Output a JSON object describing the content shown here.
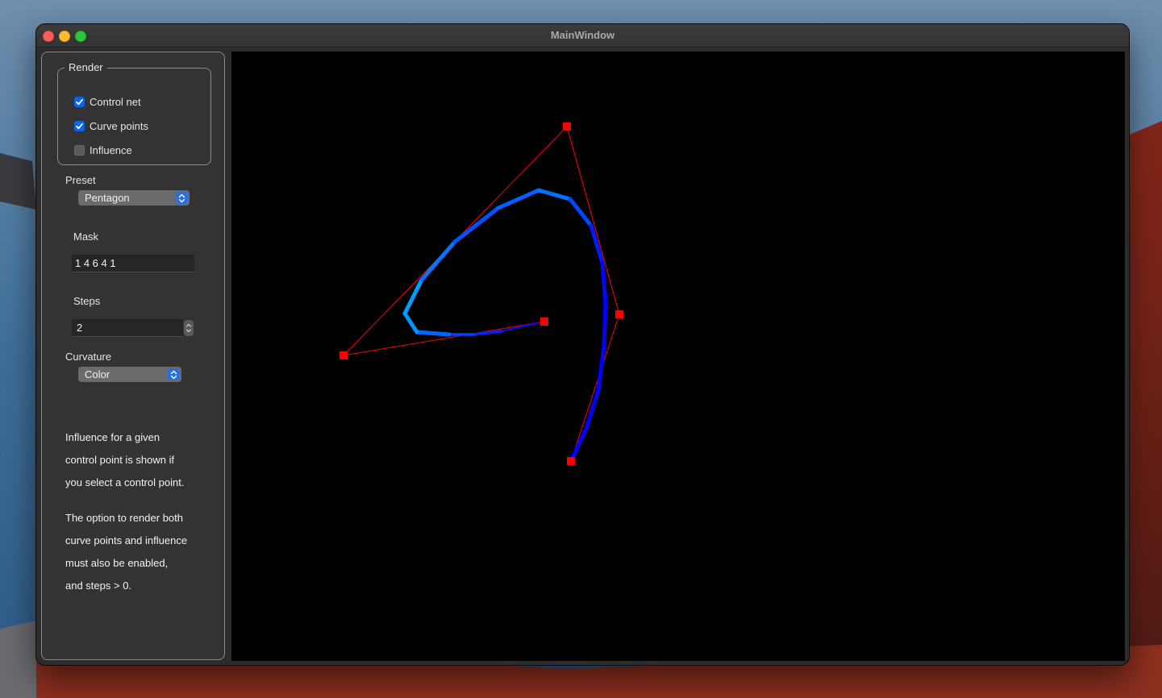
{
  "window": {
    "title": "MainWindow"
  },
  "render_group": {
    "title": "Render",
    "options": [
      {
        "label": "Control net",
        "checked": true
      },
      {
        "label": "Curve points",
        "checked": true
      },
      {
        "label": "Influence",
        "checked": false
      }
    ]
  },
  "preset": {
    "label": "Preset",
    "value": "Pentagon"
  },
  "mask": {
    "label": "Mask",
    "value": "1 4 6 4 1"
  },
  "steps": {
    "label": "Steps",
    "value": "2"
  },
  "curvature": {
    "label": "Curvature",
    "value": "Color"
  },
  "help": {
    "paragraph1": [
      "Influence for a given",
      "control point is shown if",
      "you select a control point."
    ],
    "paragraph2": [
      "The option to render both",
      "curve points and influence",
      "must also be enabled,",
      "and steps > 0."
    ]
  },
  "colors": {
    "control_net": "#ff0000",
    "control_point": "#ff0000",
    "curve_low_curvature": "#0000ff",
    "curve_high_curvature": "#00ccff"
  }
}
